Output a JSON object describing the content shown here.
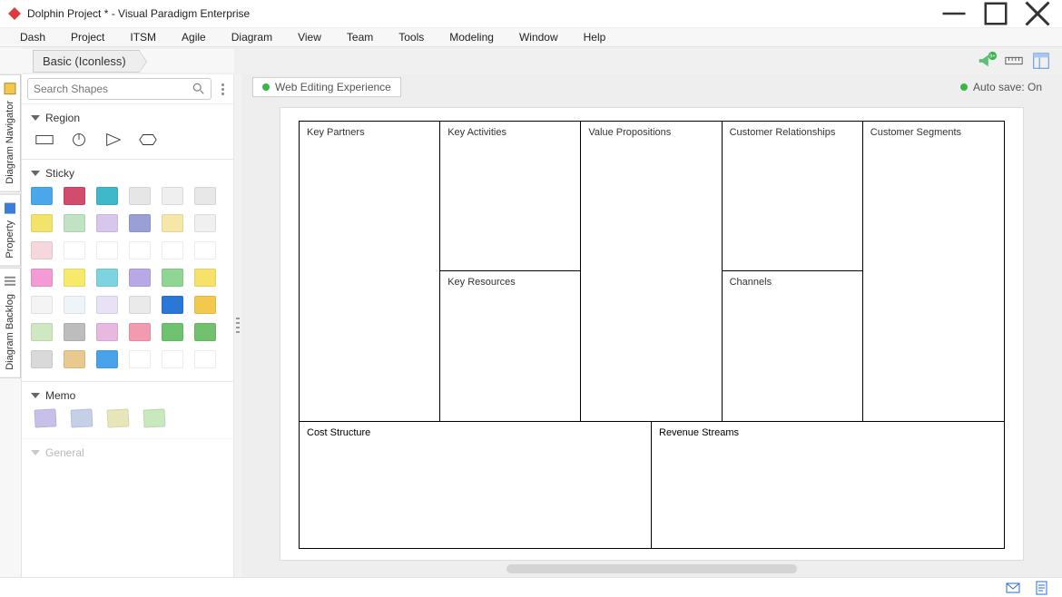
{
  "window": {
    "title": "Dolphin Project * - Visual Paradigm Enterprise"
  },
  "menubar": [
    "Dash",
    "Project",
    "ITSM",
    "Agile",
    "Diagram",
    "View",
    "Team",
    "Tools",
    "Modeling",
    "Window",
    "Help"
  ],
  "breadcrumb": {
    "current": "Basic (Iconless)"
  },
  "rail_tabs": [
    "Diagram Navigator",
    "Property",
    "Diagram Backlog"
  ],
  "search": {
    "placeholder": "Search Shapes"
  },
  "palette": {
    "sections": [
      {
        "name": "Region"
      },
      {
        "name": "Sticky"
      },
      {
        "name": "Memo"
      },
      {
        "name": "General"
      }
    ],
    "sticky_colors_rows": [
      [
        "#4aa8e8",
        "#d14d6e",
        "#3fb8c9",
        "#e6e6e6",
        "#efefef",
        "#e8e8e8"
      ],
      [
        "#f2e36a",
        "#bfe3c3",
        "#d8c7ed",
        "#9aa0d6",
        "#f6e6a8",
        "#f0f0f0"
      ],
      [
        "#f7d7de",
        "#ffffff",
        "#ffffff",
        "#ffffff",
        "#ffffff",
        "#ffffff"
      ],
      [
        "#f29bd4",
        "#f7e96a",
        "#7dd3e0",
        "#b9a8e6",
        "#8fd694",
        "#f6e26a"
      ],
      [
        "#f4f4f4",
        "#eef5f8",
        "#e9e1f5",
        "#eaeaea",
        "#2a77d6",
        "#f2c94c"
      ],
      [
        "#cfe8c1",
        "#bdbdbd",
        "#e7b8e0",
        "#f29bb0",
        "#6fc26f",
        "#73c06e"
      ],
      [
        "#d9d9d9",
        "#e8c98f",
        "#4aa3ea",
        "#ffffff",
        "#ffffff",
        "#ffffff"
      ]
    ],
    "memo_colors": [
      "#c9c0ea",
      "#c4cfe8",
      "#e8e6b8",
      "#c9e8bd"
    ]
  },
  "toolbar_icons": [
    "announce-icon",
    "ruler-icon",
    "layout-icon"
  ],
  "status": {
    "left": "Web Editing Experience",
    "right": "Auto save: On"
  },
  "canvas": {
    "cells": {
      "key_partners": "Key Partners",
      "key_activities": "Key Activities",
      "key_resources": "Key Resources",
      "value_propositions": "Value Propositions",
      "customer_relationships": "Customer Relationships",
      "channels": "Channels",
      "customer_segments": "Customer Segments",
      "cost_structure": "Cost Structure",
      "revenue_streams": "Revenue Streams"
    }
  }
}
